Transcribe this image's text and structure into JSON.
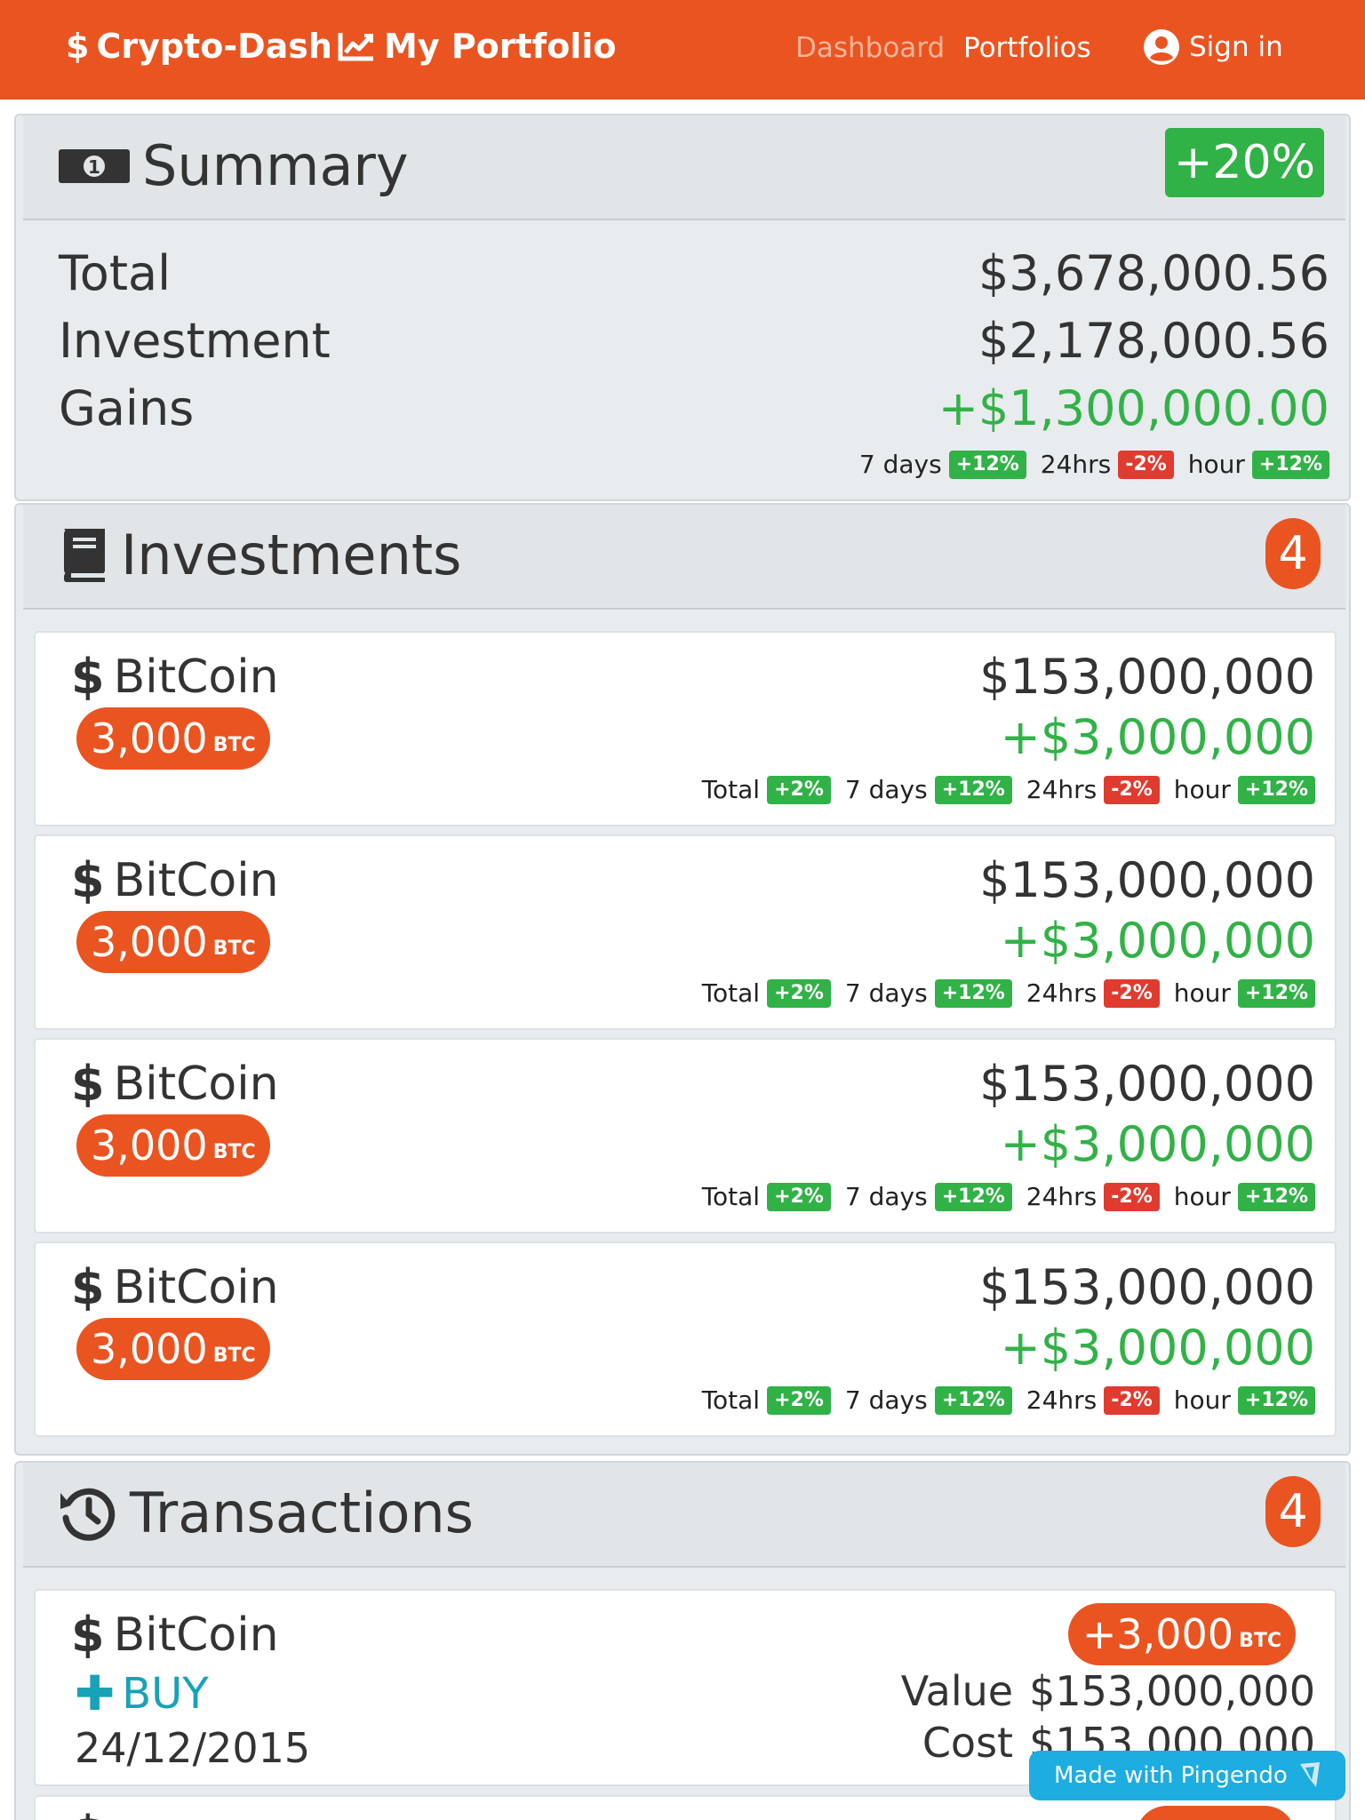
{
  "colors": {
    "accent": "#ea5421",
    "positive": "#31b247",
    "negative": "#e03b2f",
    "info": "#17a2b8"
  },
  "nav": {
    "brand": "Crypto-Dash",
    "brand_icon": "dollar-icon",
    "portfolio": "My Portfolio",
    "portfolio_icon": "chart-line-icon",
    "links": {
      "dashboard": "Dashboard",
      "portfolios": "Portfolios",
      "signin": "Sign in"
    },
    "signin_icon": "user-circle-icon"
  },
  "summary": {
    "title": "Summary",
    "icon": "money-bill-icon",
    "change": "+20%",
    "rows": {
      "total": {
        "label": "Total",
        "value": "$3,678,000.56"
      },
      "investment": {
        "label": "Investment",
        "value": "$2,178,000.56"
      },
      "gains": {
        "label": "Gains",
        "value": "+$1,300,000.00"
      }
    },
    "changes": {
      "d7_label": "7 days",
      "d7": "+12%",
      "h24_label": "24hrs",
      "h24": "-2%",
      "hour_label": "hour",
      "hour": "+12%"
    }
  },
  "investments": {
    "title": "Investments",
    "icon": "book-icon",
    "count": "4",
    "items": [
      {
        "name": "BitCoin",
        "amount": "3,000",
        "unit": "BTC",
        "value": "$153,000,000",
        "gain": "+$3,000,000",
        "total_label": "Total",
        "total": "+2%",
        "d7_label": "7 days",
        "d7": "+12%",
        "h24_label": "24hrs",
        "h24": "-2%",
        "hour_label": "hour",
        "hour": "+12%"
      },
      {
        "name": "BitCoin",
        "amount": "3,000",
        "unit": "BTC",
        "value": "$153,000,000",
        "gain": "+$3,000,000",
        "total_label": "Total",
        "total": "+2%",
        "d7_label": "7 days",
        "d7": "+12%",
        "h24_label": "24hrs",
        "h24": "-2%",
        "hour_label": "hour",
        "hour": "+12%"
      },
      {
        "name": "BitCoin",
        "amount": "3,000",
        "unit": "BTC",
        "value": "$153,000,000",
        "gain": "+$3,000,000",
        "total_label": "Total",
        "total": "+2%",
        "d7_label": "7 days",
        "d7": "+12%",
        "h24_label": "24hrs",
        "h24": "-2%",
        "hour_label": "hour",
        "hour": "+12%"
      },
      {
        "name": "BitCoin",
        "amount": "3,000",
        "unit": "BTC",
        "value": "$153,000,000",
        "gain": "+$3,000,000",
        "total_label": "Total",
        "total": "+2%",
        "d7_label": "7 days",
        "d7": "+12%",
        "h24_label": "24hrs",
        "h24": "-2%",
        "hour_label": "hour",
        "hour": "+12%"
      }
    ]
  },
  "transactions": {
    "title": "Transactions",
    "icon": "history-icon",
    "count": "4",
    "items": [
      {
        "name": "BitCoin",
        "type": "BUY",
        "date": "24/12/2015",
        "amount": "+3,000",
        "unit": "BTC",
        "value_label": "Value",
        "value": "$153,000,000",
        "cost_label": "Cost",
        "cost": "$153,000,000"
      }
    ]
  },
  "pingendo": {
    "label": "Made with Pingendo",
    "icon": "pingendo-logo-icon"
  }
}
